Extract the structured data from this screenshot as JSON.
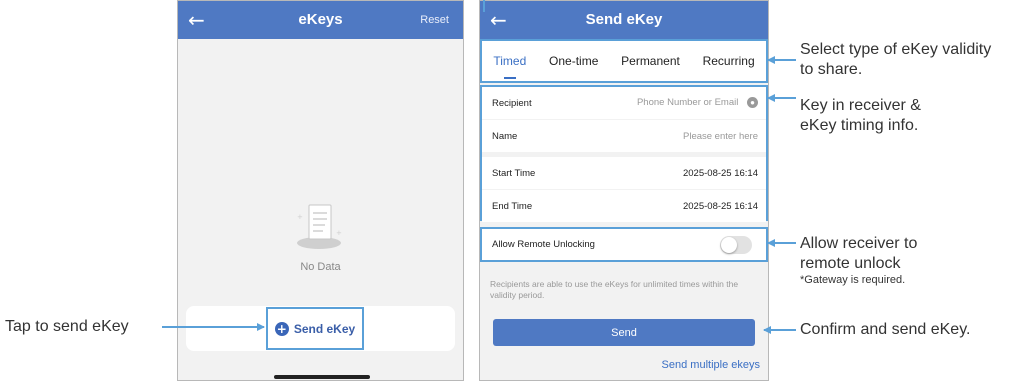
{
  "left_screen": {
    "title": "eKeys",
    "reset_label": "Reset",
    "back_icon": "back-arrow-icon",
    "empty_text": "No Data",
    "send_button_label": "Send eKey"
  },
  "right_screen": {
    "title": "Send eKey",
    "back_icon": "back-arrow-icon",
    "tabs": [
      {
        "label": "Timed",
        "active": true
      },
      {
        "label": "One-time",
        "active": false
      },
      {
        "label": "Permanent",
        "active": false
      },
      {
        "label": "Recurring",
        "active": false
      }
    ],
    "recipient": {
      "label": "Recipient",
      "placeholder": "Phone Number or Email"
    },
    "name": {
      "label": "Name",
      "placeholder": "Please enter here"
    },
    "start_time": {
      "label": "Start Time",
      "value": "2025-08-25 16:14"
    },
    "end_time": {
      "label": "End Time",
      "value": "2025-08-25 16:14"
    },
    "remote_unlocking": {
      "label": "Allow Remote Unlocking",
      "enabled": false
    },
    "note": "Recipients are able to use the eKeys for unlimited times within the validity period.",
    "send_label": "Send",
    "send_multiple_label": "Send multiple ekeys"
  },
  "annotations": {
    "tap_send": "Tap to send eKey",
    "validity_line1": "Select type of eKey validity",
    "validity_line2": "to share.",
    "info_line1": "Key in receiver &",
    "info_line2": "eKey timing info.",
    "remote_line1": "Allow receiver to",
    "remote_line2": "remote unlock",
    "remote_note": "*Gateway is required.",
    "confirm": "Confirm and send eKey."
  },
  "colors": {
    "navbar": "#4f79c3",
    "highlight_border": "#5aa0d8",
    "accent_text": "#3a6fc4"
  }
}
